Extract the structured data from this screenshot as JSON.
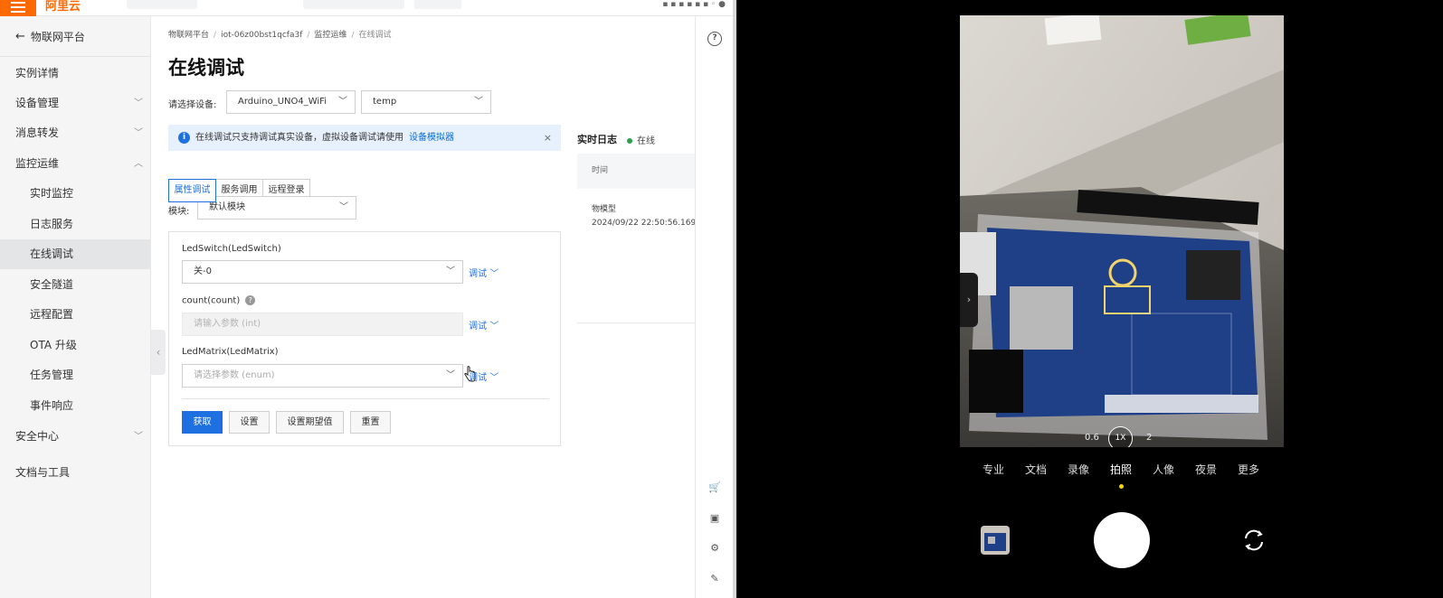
{
  "topbar": {
    "brand": "阿里云",
    "menu_icon": "hamburger-icon"
  },
  "sidebar": {
    "back_label": "物联网平台",
    "items": [
      {
        "label": "实例详情"
      },
      {
        "label": "设备管理"
      },
      {
        "label": "消息转发"
      },
      {
        "label": "监控运维"
      },
      {
        "label": "实时监控"
      },
      {
        "label": "日志服务"
      },
      {
        "label": "在线调试"
      },
      {
        "label": "安全隧道"
      },
      {
        "label": "远程配置"
      },
      {
        "label": "OTA 升级"
      },
      {
        "label": "任务管理"
      },
      {
        "label": "事件响应"
      },
      {
        "label": "安全中心"
      },
      {
        "label": "文档与工具"
      }
    ]
  },
  "breadcrumb": {
    "items": [
      "物联网平台",
      "iot-06z00bst1qcfa3f",
      "监控运维",
      "在线调试"
    ]
  },
  "page": {
    "title": "在线调试"
  },
  "device": {
    "label": "请选择设备:",
    "product": "Arduino_UNO4_WiFi",
    "device_name": "temp"
  },
  "notice": {
    "text": "在线调试只支持调试真实设备，虚拟设备调试请使用",
    "link": "设备模拟器",
    "close": "×"
  },
  "tabs": [
    {
      "label": "属性调试",
      "active": true
    },
    {
      "label": "服务调用",
      "active": false
    },
    {
      "label": "远程登录",
      "active": false
    }
  ],
  "module": {
    "label": "模块:",
    "value": "默认模块"
  },
  "properties": [
    {
      "label": "LedSwitch(LedSwitch)",
      "value": "关-0",
      "debug": "调试"
    },
    {
      "label": "count(count)",
      "placeholder": "请输入参数 (int)",
      "debug": "调试"
    },
    {
      "label": "LedMatrix(LedMatrix)",
      "placeholder": "请选择参数 (enum)",
      "debug": "调试"
    }
  ],
  "actions": {
    "get": "获取",
    "set": "设置",
    "set_expected": "设置期望值",
    "reset": "重置"
  },
  "log": {
    "title": "实时日志",
    "status": "在线",
    "column_time": "时间",
    "entry_type": "物模型",
    "entry_time": "2024/09/22 22:50:56.169"
  },
  "camera": {
    "modes": [
      "专业",
      "文档",
      "录像",
      "拍照",
      "人像",
      "夜景",
      "更多"
    ],
    "active_mode": "拍照",
    "zoom": {
      "wide": "0.6",
      "current": "1X",
      "tele": "2"
    }
  },
  "colors": {
    "accent": "#1e6fe0",
    "brand": "#ff6a00",
    "online": "#2ba14b",
    "mode_dot": "#f5d400"
  }
}
